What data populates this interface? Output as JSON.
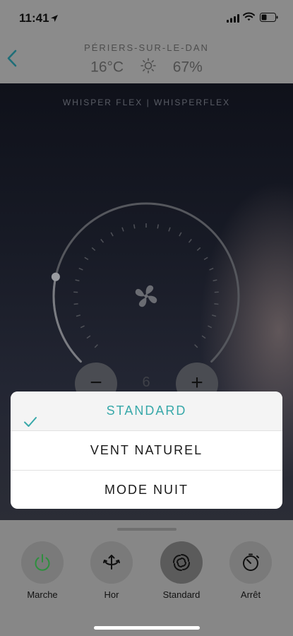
{
  "status_bar": {
    "time": "11:41"
  },
  "header": {
    "city": "PÉRIERS-SUR-LE-DAN",
    "temperature": "16°C",
    "humidity": "67%"
  },
  "device": {
    "name": "WHISPER FLEX | WHISPERFLEX"
  },
  "speed": {
    "value": "6",
    "minus_label": "−",
    "plus_label": "+"
  },
  "mode_picker": {
    "options": [
      {
        "label": "STANDARD",
        "selected": true
      },
      {
        "label": "VENT NATUREL",
        "selected": false
      },
      {
        "label": "MODE NUIT",
        "selected": false
      }
    ],
    "accent_color": "#37a8a9"
  },
  "controls": [
    {
      "label": "Marche",
      "icon": "power-icon"
    },
    {
      "label": "Hor",
      "icon": "oscillation-icon"
    },
    {
      "label": "Standard",
      "icon": "fan-mode-icon"
    },
    {
      "label": "Arrêt",
      "icon": "timer-icon"
    }
  ]
}
